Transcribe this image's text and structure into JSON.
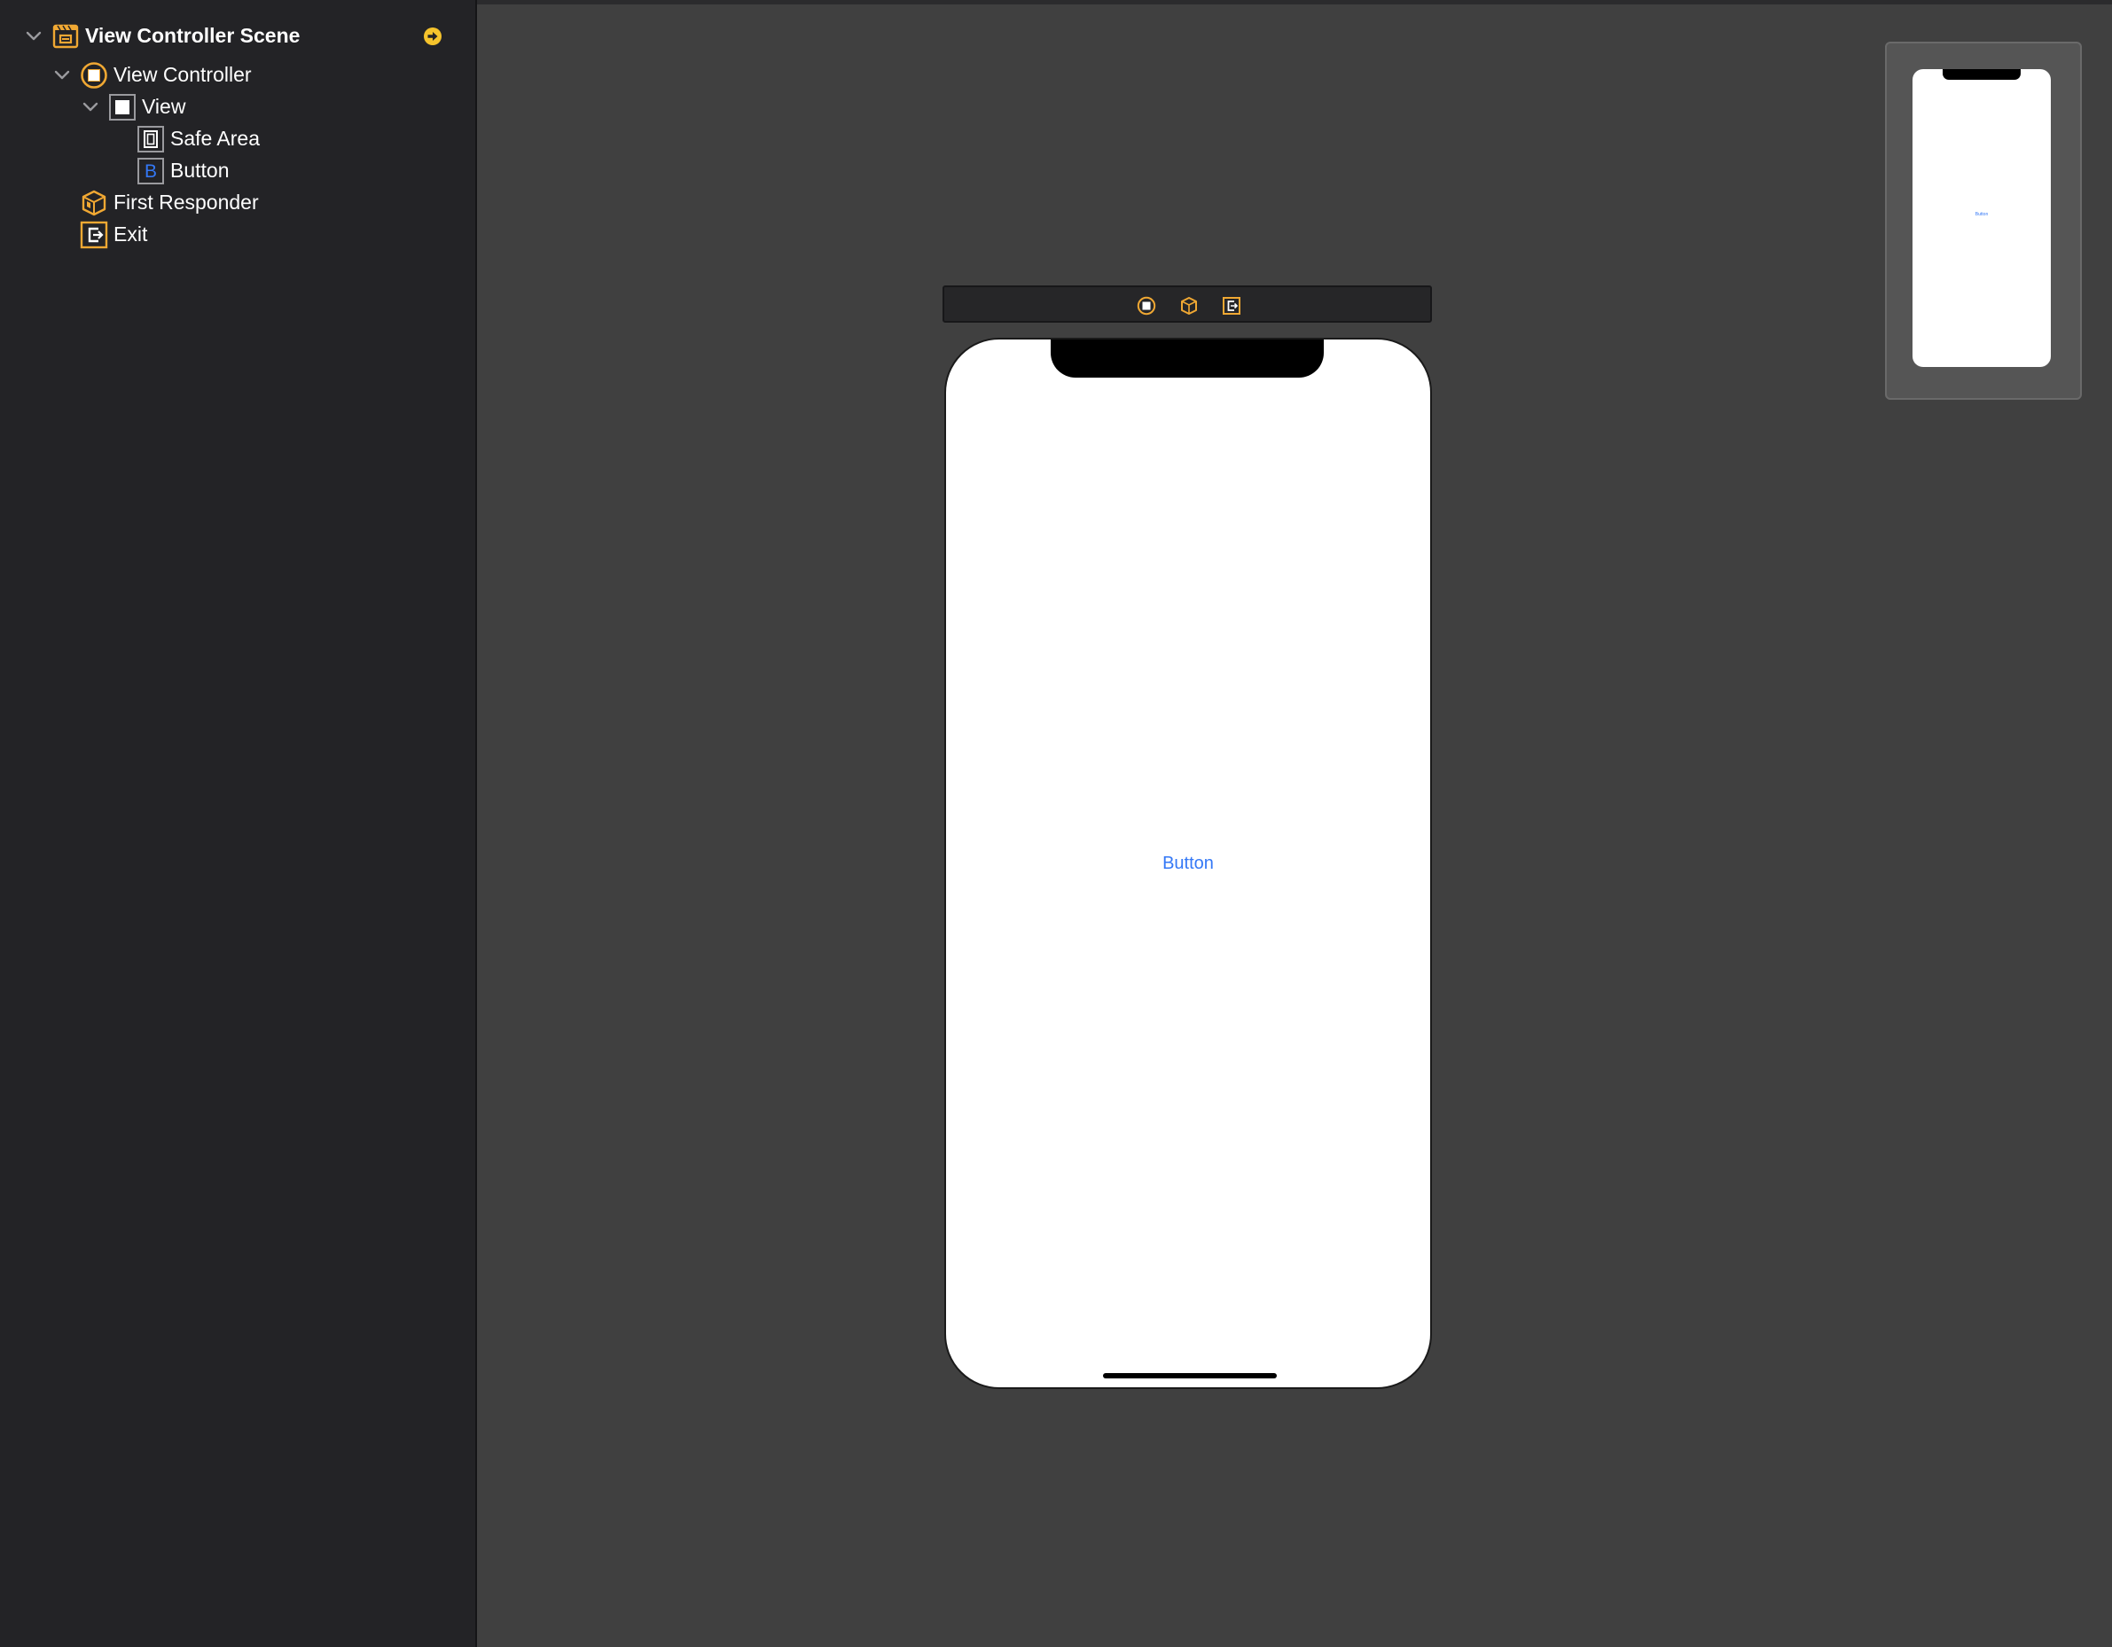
{
  "outline": {
    "scene": {
      "label": "View Controller Scene"
    },
    "view_controller": {
      "label": "View Controller"
    },
    "view": {
      "label": "View"
    },
    "safe_area": {
      "label": "Safe Area"
    },
    "button": {
      "label": "Button",
      "icon_letter": "B"
    },
    "first_responder": {
      "label": "First Responder"
    },
    "exit": {
      "label": "Exit"
    }
  },
  "canvas": {
    "button_title": "Button"
  },
  "minimap": {
    "button_title": "Button"
  },
  "colors": {
    "accent_orange": "#f0a833",
    "button_blue": "#3478f6",
    "canvas_bg": "#404040",
    "sidebar_bg": "#232326"
  }
}
